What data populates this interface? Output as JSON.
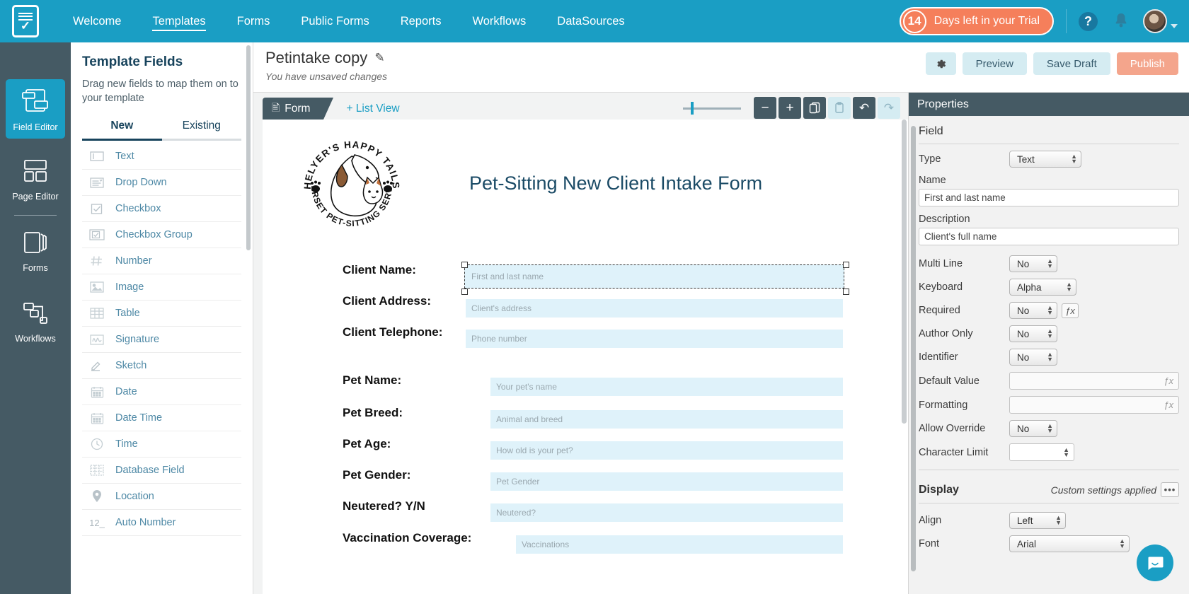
{
  "topnav": {
    "logo_name": "app-logo",
    "items": [
      {
        "label": "Welcome",
        "active": false
      },
      {
        "label": "Templates",
        "active": true
      },
      {
        "label": "Forms",
        "active": false
      },
      {
        "label": "Public Forms",
        "active": false
      },
      {
        "label": "Reports",
        "active": false
      },
      {
        "label": "Workflows",
        "active": false
      },
      {
        "label": "DataSources",
        "active": false
      }
    ],
    "trial_days": "14",
    "trial_text": "Days left in your Trial",
    "help_glyph": "?",
    "accent": "#1a9ec4",
    "trial_color": "#f57f5b"
  },
  "rail": {
    "items": [
      {
        "label": "Field Editor",
        "icon": "field-editor-icon",
        "active": true
      },
      {
        "label": "Page Editor",
        "icon": "page-editor-icon",
        "active": false
      },
      {
        "label": "Forms",
        "icon": "forms-icon",
        "active": false
      },
      {
        "label": "Workflows",
        "icon": "workflows-icon",
        "active": false
      }
    ]
  },
  "field_panel": {
    "title": "Template Fields",
    "subtitle": "Drag new fields to map them on to your template",
    "tabs": [
      {
        "label": "New",
        "active": true
      },
      {
        "label": "Existing",
        "active": false
      }
    ],
    "fields": [
      {
        "label": "Text",
        "icon": "text-field-icon"
      },
      {
        "label": "Drop Down",
        "icon": "dropdown-field-icon"
      },
      {
        "label": "Checkbox",
        "icon": "checkbox-field-icon"
      },
      {
        "label": "Checkbox Group",
        "icon": "checkbox-group-field-icon"
      },
      {
        "label": "Number",
        "icon": "number-field-icon"
      },
      {
        "label": "Image",
        "icon": "image-field-icon"
      },
      {
        "label": "Table",
        "icon": "table-field-icon"
      },
      {
        "label": "Signature",
        "icon": "signature-field-icon"
      },
      {
        "label": "Sketch",
        "icon": "sketch-field-icon"
      },
      {
        "label": "Date",
        "icon": "date-field-icon"
      },
      {
        "label": "Date Time",
        "icon": "datetime-field-icon"
      },
      {
        "label": "Time",
        "icon": "time-field-icon"
      },
      {
        "label": "Database Field",
        "icon": "database-field-icon"
      },
      {
        "label": "Location",
        "icon": "location-field-icon"
      },
      {
        "label": "Auto Number",
        "icon": "autonumber-field-icon"
      }
    ]
  },
  "main_header": {
    "template_name": "Petintake copy",
    "status": "You have unsaved changes",
    "buttons": [
      {
        "label": "Preview",
        "kind": "secondary"
      },
      {
        "label": "Save Draft",
        "kind": "secondary"
      },
      {
        "label": "Publish",
        "kind": "primary"
      }
    ],
    "gear_label": "Settings"
  },
  "canvas_toolbar": {
    "tab_form": "Form",
    "tab_list": "+ List View",
    "zoom_out": "−",
    "zoom_in": "+",
    "copy_label": "Copy",
    "paste_label": "Paste",
    "undo_label": "Undo",
    "redo_label": "Redo"
  },
  "document": {
    "logo": {
      "top_text": "HELYER'S HAPPY TAILS",
      "bottom_text": "SOMERSET PET-SITTING SERVICES"
    },
    "title": "Pet-Sitting New Client Intake Form",
    "rows": [
      {
        "label": "Client Name:",
        "placeholder": "First and last name",
        "selected": true
      },
      {
        "label": "Client Address:",
        "placeholder": "Client's address",
        "selected": false
      },
      {
        "label": "Client Telephone:",
        "placeholder": "Phone number",
        "selected": false
      },
      {
        "label": "Pet Name:",
        "placeholder": "Your pet's name",
        "selected": false
      },
      {
        "label": "Pet Breed:",
        "placeholder": "Animal and breed",
        "selected": false
      },
      {
        "label": "Pet Age:",
        "placeholder": "How old is your pet?",
        "selected": false
      },
      {
        "label": "Pet Gender:",
        "placeholder": "Pet Gender",
        "selected": false
      },
      {
        "label": "Neutered? Y/N",
        "placeholder": "Neutered?",
        "selected": false
      },
      {
        "label": "Vaccination Coverage:",
        "placeholder": "Vaccinations",
        "selected": false
      }
    ]
  },
  "properties": {
    "header": "Properties",
    "field_section": "Field",
    "type_label": "Type",
    "type_value": "Text",
    "name_label": "Name",
    "name_value": "First and last name",
    "description_label": "Description",
    "description_value": "Client's full name",
    "multiline_label": "Multi Line",
    "multiline_value": "No",
    "keyboard_label": "Keyboard",
    "keyboard_value": "Alpha",
    "required_label": "Required",
    "required_value": "No",
    "author_only_label": "Author Only",
    "author_only_value": "No",
    "identifier_label": "Identifier",
    "identifier_value": "No",
    "default_value_label": "Default Value",
    "default_value_value": "",
    "formatting_label": "Formatting",
    "formatting_value": "",
    "allow_override_label": "Allow Override",
    "allow_override_value": "No",
    "character_limit_label": "Character Limit",
    "character_limit_value": "",
    "display_section": "Display",
    "display_note": "Custom settings applied",
    "align_label": "Align",
    "align_value": "Left",
    "font_label": "Font",
    "font_value": "Arial",
    "fx_glyph": "ƒx",
    "dots_glyph": "•••"
  }
}
